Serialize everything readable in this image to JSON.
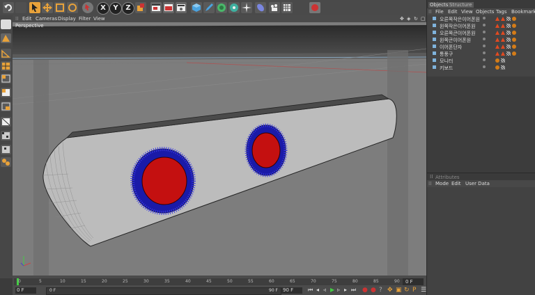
{
  "toolbar": {
    "icons": [
      "undo-icon",
      "redo-icon",
      "selection-icon",
      "move-icon",
      "scale-icon",
      "rotate-icon",
      "object-mode-icon",
      "x-axis-icon",
      "y-axis-icon",
      "z-axis-icon",
      "world-coord-icon",
      "render-view-icon",
      "render-picture-viewer-icon",
      "render-settings-icon",
      "cube-icon",
      "pen-icon",
      "subdivision-icon",
      "array-icon",
      "deformer-icon",
      "scene-icon",
      "camera-icon",
      "light-icon",
      "record-icon"
    ],
    "axis_x": "X",
    "axis_y": "Y",
    "axis_z": "Z"
  },
  "viewport": {
    "menu": [
      "Edit",
      "Cameras",
      "Display",
      "Filter",
      "View"
    ],
    "label": "Perspective"
  },
  "timeline": {
    "ticks": [
      "0",
      "5",
      "10",
      "15",
      "20",
      "25",
      "30",
      "35",
      "40",
      "45",
      "50",
      "55",
      "60",
      "65",
      "70",
      "75",
      "80",
      "85",
      "90"
    ],
    "frame_field_right": "0 F",
    "start_field": "0 F",
    "current_field": "0 F",
    "mid_field": "90 F",
    "end_field": "90 F"
  },
  "objects_panel": {
    "tabs": [
      "Objects",
      "Structure"
    ],
    "menu": [
      "File",
      "Edit",
      "View",
      "Objects",
      "Tags",
      "Bookmarks"
    ],
    "items": [
      {
        "name": "오른쪽작은이어폰원",
        "tags": [
          "A",
          "A",
          "C",
          "K"
        ]
      },
      {
        "name": "왼쪽작은이어폰원",
        "tags": [
          "A",
          "A",
          "C",
          "K"
        ]
      },
      {
        "name": "오른쪽큰이어폰원",
        "tags": [
          "A",
          "A",
          "C",
          "K"
        ]
      },
      {
        "name": "왼쪽큰이어폰원",
        "tags": [
          "A",
          "A",
          "C",
          "K"
        ]
      },
      {
        "name": "이어폰단자",
        "tags": [
          "A",
          "A",
          "C",
          "K"
        ]
      },
      {
        "name": "통풍구",
        "tags": [
          "A",
          "A",
          "C",
          "K"
        ]
      },
      {
        "name": "모니터",
        "tags": [
          "K",
          "C"
        ]
      },
      {
        "name": "키보드",
        "tags": [
          "K",
          "C"
        ]
      }
    ]
  },
  "attributes_panel": {
    "title": "Attributes",
    "menu": [
      "Mode",
      "Edit",
      "User Data"
    ]
  },
  "colors": {
    "accent_orange": "#e8a23a",
    "tag_red": "#e24a20",
    "speaker_red": "#c41010",
    "speaker_blue": "#1a1aa8"
  }
}
